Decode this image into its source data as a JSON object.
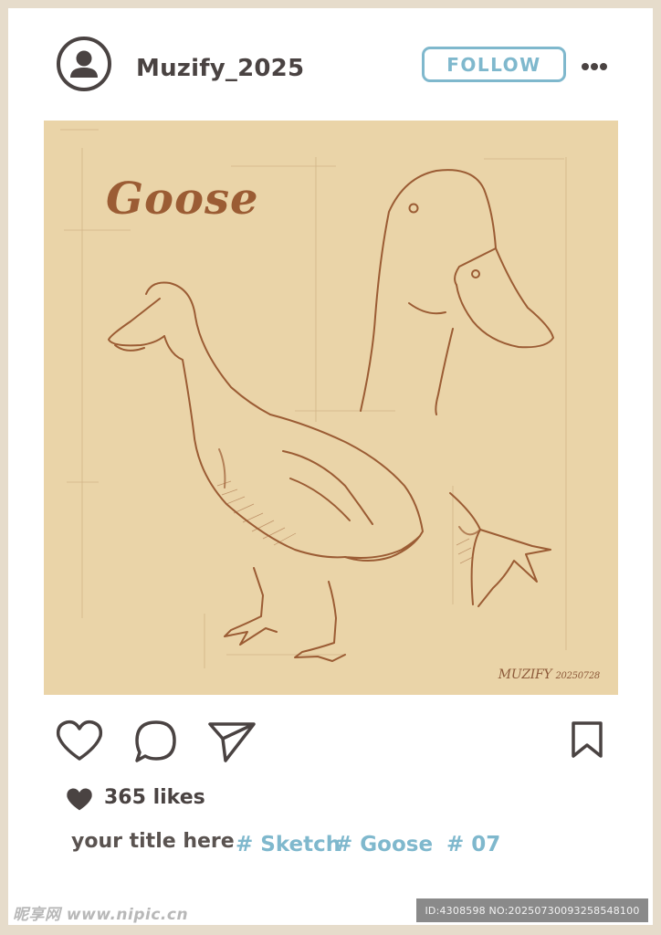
{
  "header": {
    "username": "Muzify_2025",
    "follow_label": "FOLLOW",
    "avatar_icon": "user-avatar-icon",
    "more_icon": "more-horizontal-icon"
  },
  "post": {
    "title": "Goose",
    "signature_name": "MUZIFY",
    "signature_date": "20250728",
    "background_color": "#ead4a8",
    "sketch_color": "#9b5c34"
  },
  "actions": {
    "like_icon": "heart-outline-icon",
    "comment_icon": "comment-bubble-icon",
    "share_icon": "send-icon",
    "save_icon": "bookmark-icon"
  },
  "likes": {
    "icon": "heart-filled-icon",
    "text": "365 likes"
  },
  "caption": {
    "text": "your title here",
    "tags": [
      "# Sketch",
      "# Goose",
      "# 07"
    ],
    "tag_color": "#7fb8cd"
  },
  "watermark": {
    "left": "昵享网 www.nipic.cn",
    "right": "ID:4308598 NO:20250730093258548100"
  }
}
